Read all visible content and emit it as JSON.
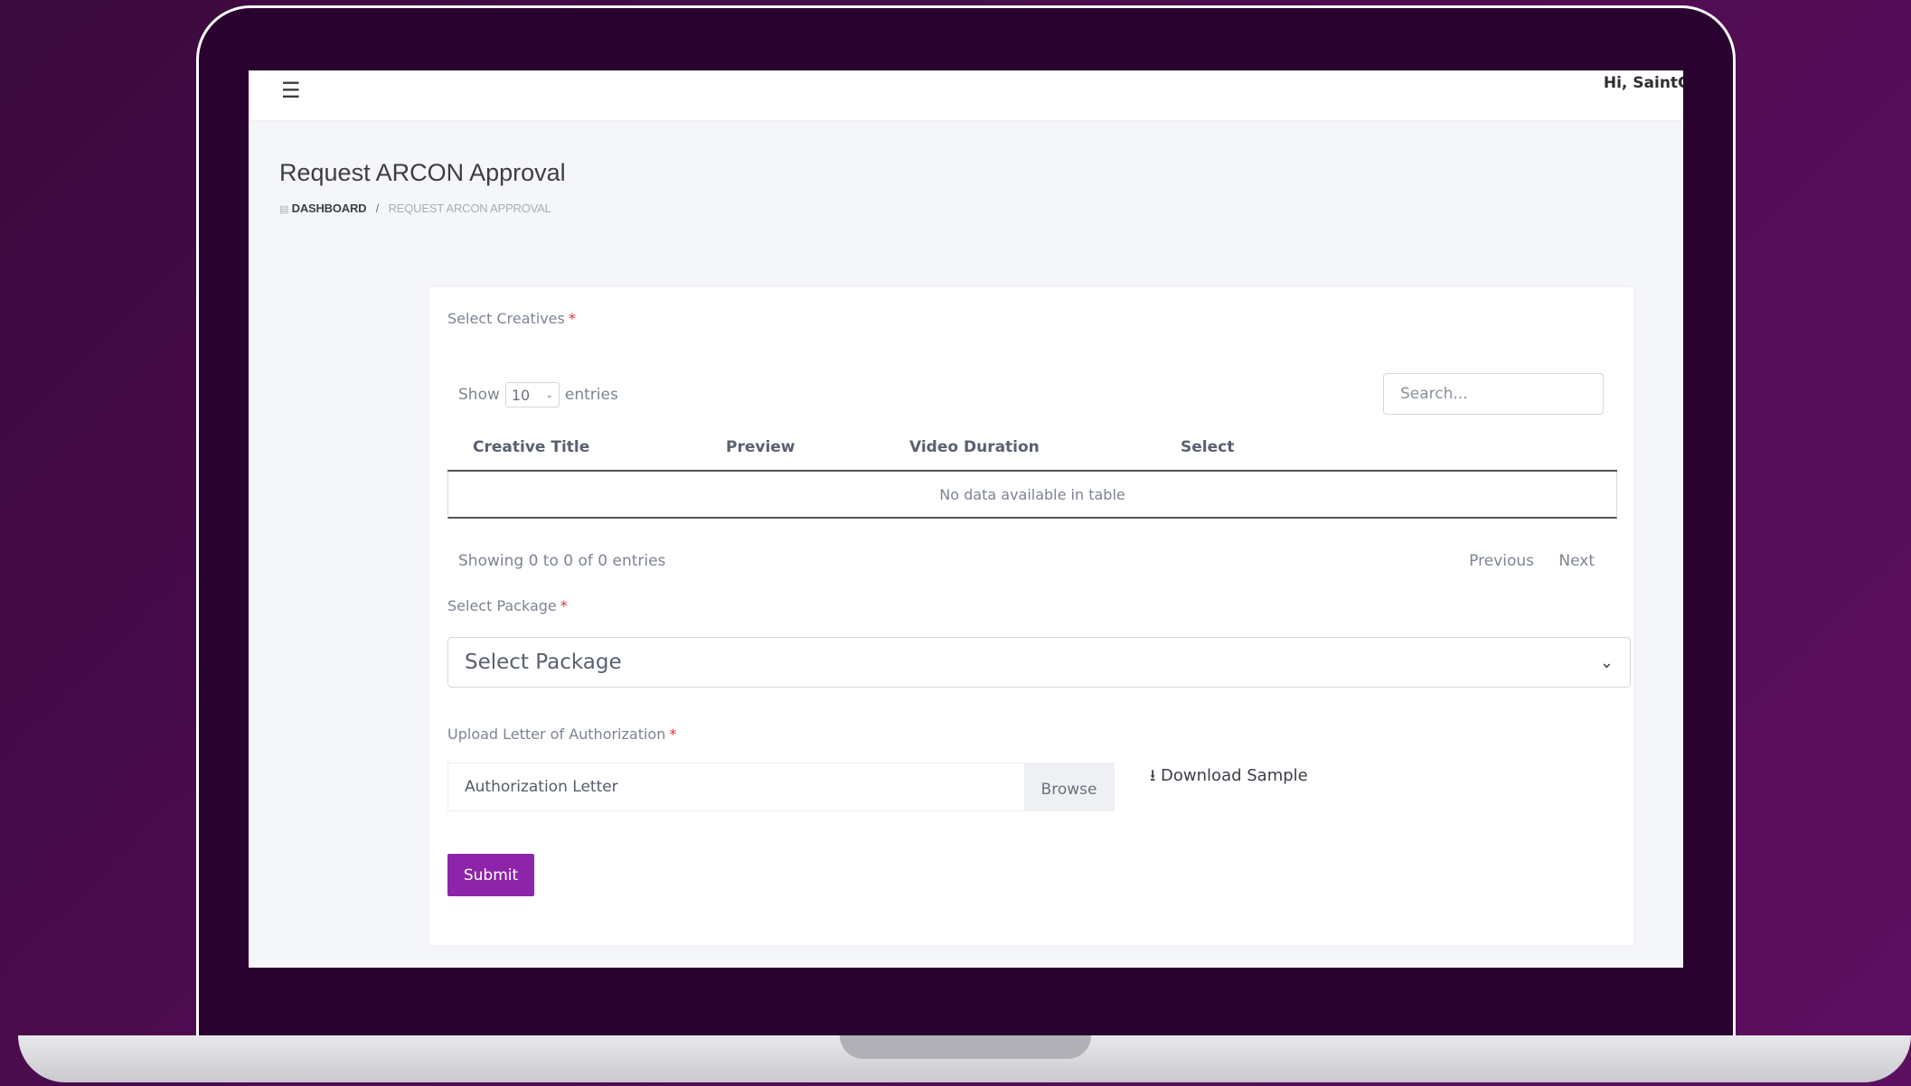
{
  "topbar": {
    "menu_icon": "hamburger-menu-icon",
    "greeting": "Hi, SaintG"
  },
  "page": {
    "title": "Request ARCON Approval"
  },
  "breadcrumb": {
    "home_icon": "dashboard-icon",
    "home": "DASHBOARD",
    "separator": "/",
    "current": "REQUEST ARCON APPROVAL"
  },
  "creatives": {
    "label": "Select Creatives",
    "required_mark": "*",
    "show_prefix": "Show",
    "page_length": "10",
    "show_suffix": "entries",
    "search_placeholder": "Search...",
    "columns": [
      "Creative Title",
      "Preview",
      "Video Duration",
      "Select"
    ],
    "empty_message": "No data available in table",
    "info": "Showing 0 to 0 of 0 entries",
    "prev_label": "Previous",
    "next_label": "Next"
  },
  "package": {
    "label": "Select Package",
    "required_mark": "*",
    "selected": "Select Package"
  },
  "authorization": {
    "label": "Upload Letter of Authorization",
    "required_mark": "*",
    "file_placeholder": "Authorization Letter",
    "browse_label": "Browse",
    "download_label": "Download Sample",
    "download_icon": "download-icon"
  },
  "form": {
    "submit_label": "Submit"
  },
  "colors": {
    "accent": "#8e24aa",
    "required": "#e0323a",
    "background": "#4e0c51"
  }
}
